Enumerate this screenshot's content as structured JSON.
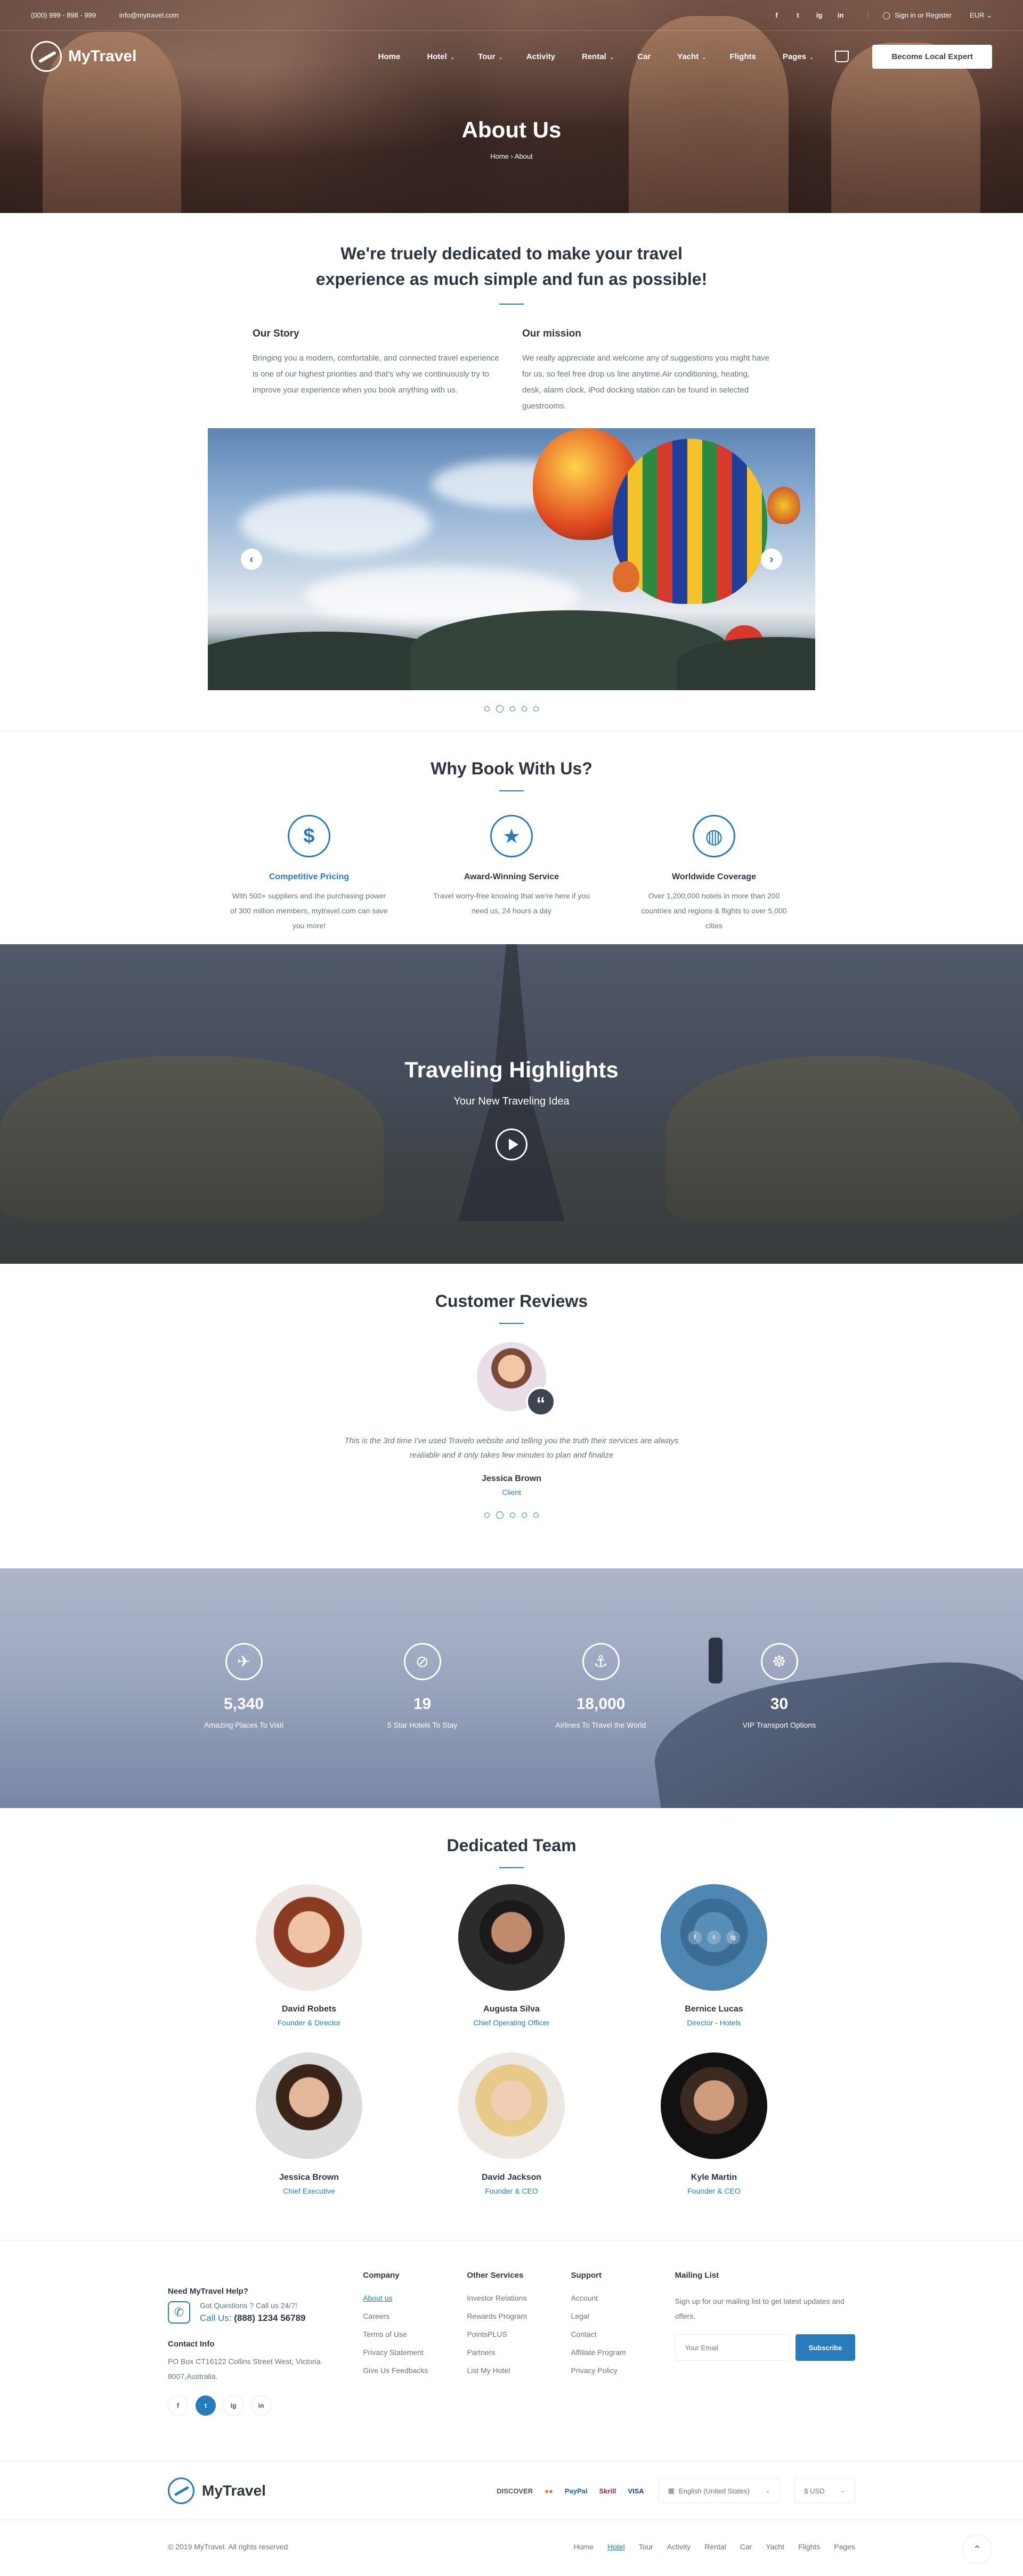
{
  "topbar": {
    "phone": "(000) 999 - 898 - 999",
    "email": "info@mytravel.com",
    "social": [
      "f",
      "t",
      "ig",
      "in"
    ],
    "signin": "Sign in or Register",
    "currency": "EUR"
  },
  "nav": {
    "brand": "MyTravel",
    "items": [
      {
        "label": "Home",
        "caret": ""
      },
      {
        "label": "Hotel",
        "caret": "⌄"
      },
      {
        "label": "Tour",
        "caret": "⌄"
      },
      {
        "label": "Activity",
        "caret": ""
      },
      {
        "label": "Rental",
        "caret": "⌄"
      },
      {
        "label": "Car",
        "caret": ""
      },
      {
        "label": "Yacht",
        "caret": "⌄"
      },
      {
        "label": "Flights",
        "caret": ""
      },
      {
        "label": "Pages",
        "caret": "⌄"
      }
    ],
    "cta": "Become Local Expert"
  },
  "hero": {
    "title": "About Us",
    "crumb_home": "Home",
    "crumb_sep": "›",
    "crumb_current": "About"
  },
  "intro": {
    "heading": "We're truely dedicated to make your travel experience as much simple and fun as possible!",
    "story_title": "Our Story",
    "story_text": "Bringing you a modern, comfortable, and connected travel experience is one of our highest priorities and that's why we continuously try to improve your experience when you book anything with us.",
    "mission_title": "Our mission",
    "mission_text": "We really appreciate and welcome any of suggestions you might have for us, so feel free drop us line anytime.Air conditioning, heating, desk, alarm clock, iPod docking station can be found in selected guestrooms.",
    "prev": "‹",
    "next": "›"
  },
  "why": {
    "title": "Why Book With Us?",
    "features": [
      {
        "icon": "price-tag-icon",
        "glyph": "$",
        "title": "Competitive Pricing",
        "text": "With 500+ suppliers and the purchasing power of 300 million members, mytravel.com can save you more!"
      },
      {
        "icon": "award-icon",
        "glyph": "★",
        "title": "Award-Winning Service",
        "text": "Travel worry-free knowing that we're here if you need us, 24 hours a day"
      },
      {
        "icon": "globe-icon",
        "glyph": "◍",
        "title": "Worldwide Coverage",
        "text": "Over 1,200,000 hotels in more than 200 countries and regions & flights to over 5,000 cities"
      }
    ]
  },
  "video": {
    "title": "Traveling Highlights",
    "subtitle": "Your New Traveling Idea"
  },
  "reviews": {
    "title": "Customer Reviews",
    "quote_mark": "“",
    "text": "This is the 3rd time I've used Travelo website and telling you the truth their services are always realiable and it only takes few minutes to plan and finalize",
    "name": "Jessica Brown",
    "role": "Client"
  },
  "stats": [
    {
      "icon": "plane-icon",
      "glyph": "✈",
      "value": "5,340",
      "label": "Amazing Places To Visit"
    },
    {
      "icon": "compass-icon",
      "glyph": "⊘",
      "value": "19",
      "label": "5 Star Hotels To Stay"
    },
    {
      "icon": "anchor-icon",
      "glyph": "⚓",
      "value": "18,000",
      "label": "Airlines To Travel the World"
    },
    {
      "icon": "ship-wheel-icon",
      "glyph": "☸",
      "value": "30",
      "label": "VIP Transport Options"
    }
  ],
  "team": {
    "title": "Dedicated Team",
    "members": [
      {
        "name": "David Robets",
        "role": "Founder & Director"
      },
      {
        "name": "Augusta Silva",
        "role": "Chief Operating Officer"
      },
      {
        "name": "Bernice Lucas",
        "role": "Director - Hotels"
      },
      {
        "name": "Jessica Brown",
        "role": "Chief Executive"
      },
      {
        "name": "David Jackson",
        "role": "Founder & CEO"
      },
      {
        "name": "Kyle Martin",
        "role": "Founder & CEO"
      }
    ],
    "overlay_social": [
      "f",
      "t",
      "ig"
    ]
  },
  "footer": {
    "help_title": "Need MyTravel Help?",
    "help_question": "Got Questions ? Call us 24/7!",
    "help_call_label": "Call Us:",
    "help_phone": "(888) 1234 56789",
    "contact_title": "Contact Info",
    "address": "PO Box CT16122 Collins Street West, Victoria 8007,Australia.",
    "social": [
      "f",
      "t",
      "ig",
      "in"
    ],
    "company_title": "Company",
    "company_links": [
      "About us",
      "Careers",
      "Terms of Use",
      "Privacy Statement",
      "Give Us Feedbacks"
    ],
    "services_title": "Other Services",
    "services_links": [
      "Investor Relations",
      "Rewards Program",
      "PointsPLUS",
      "Partners",
      "List My Hotel"
    ],
    "support_title": "Support",
    "support_links": [
      "Account",
      "Legal",
      "Contact",
      "Affiliate Program",
      "Privacy Policy"
    ],
    "mail_title": "Mailing List",
    "mail_text": "Sign up for our mailing list to get latest updates and offers.",
    "mail_placeholder": "Your Email",
    "mail_button": "Subscribe",
    "brand": "MyTravel",
    "payments": [
      "DISCOVER",
      "●●",
      "PayPal",
      "Skrill",
      "VISA"
    ],
    "language": "English (United States)",
    "currency": "$ USD",
    "copyright": "© 2019 MyTravel. All rights reserved",
    "bottom_links": [
      "Home",
      "Hotel",
      "Tour",
      "Activity",
      "Rental",
      "Car",
      "Yacht",
      "Flights",
      "Pages"
    ],
    "to_top": "⌃"
  },
  "colors": {
    "accent": "#297cbb",
    "text": "#3b444f",
    "muted": "#67747c"
  }
}
